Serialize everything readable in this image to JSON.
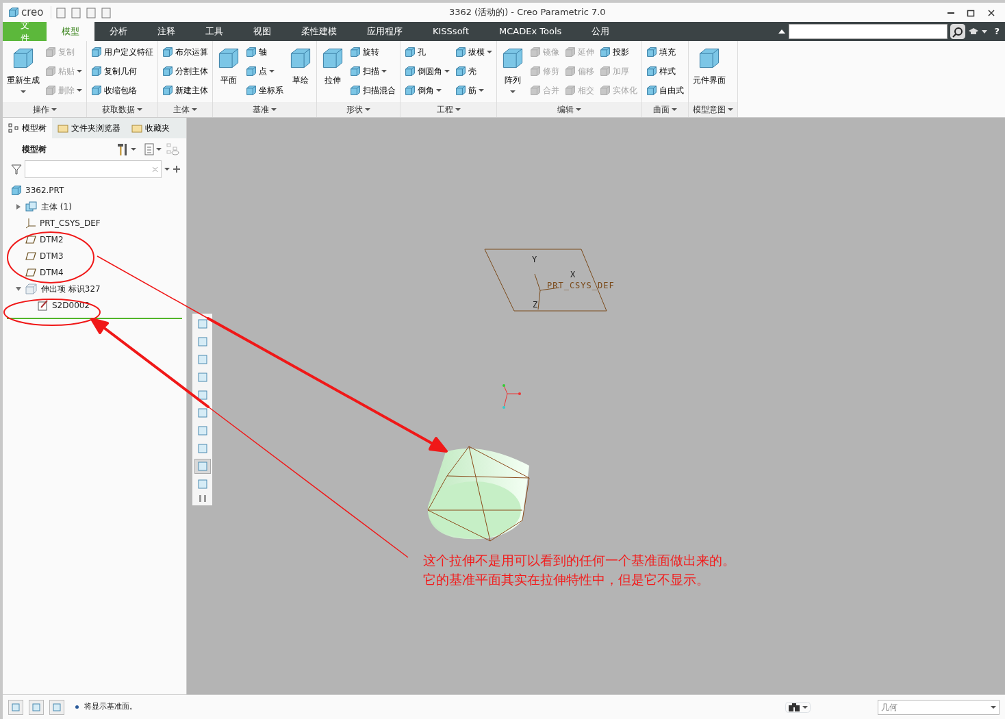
{
  "window": {
    "logo": "creo",
    "title": "3362 (活动的) - Creo Parametric 7.0"
  },
  "help": "?",
  "menu_tabs": [
    {
      "label": "文件",
      "kind": "file",
      "selected": false
    },
    {
      "label": "模型",
      "kind": "tab",
      "selected": true
    },
    {
      "label": "分析",
      "kind": "tab",
      "selected": false
    },
    {
      "label": "注释",
      "kind": "tab",
      "selected": false
    },
    {
      "label": "工具",
      "kind": "tab",
      "selected": false
    },
    {
      "label": "视图",
      "kind": "tab",
      "selected": false
    },
    {
      "label": "柔性建模",
      "kind": "tab",
      "selected": false
    },
    {
      "label": "应用程序",
      "kind": "tab",
      "selected": false
    },
    {
      "label": "KISSsoft",
      "kind": "tab",
      "selected": false
    },
    {
      "label": "MCADEx Tools",
      "kind": "tab",
      "selected": false
    },
    {
      "label": "公用",
      "kind": "tab",
      "selected": false
    }
  ],
  "ribbon_groups": [
    {
      "label": "操作",
      "items": [
        {
          "label": "重新生成",
          "kind": "large",
          "disabled": false,
          "dropdown": true
        },
        {
          "label": "复制",
          "kind": "small",
          "disabled": true,
          "dropdown": false
        },
        {
          "label": "粘贴",
          "kind": "small",
          "disabled": true,
          "dropdown": true
        },
        {
          "label": "删除",
          "kind": "small",
          "disabled": true,
          "dropdown": true
        }
      ]
    },
    {
      "label": "获取数据",
      "items": [
        {
          "label": "用户定义特征",
          "kind": "small",
          "disabled": false,
          "dropdown": false
        },
        {
          "label": "复制几何",
          "kind": "small",
          "disabled": false,
          "dropdown": false
        },
        {
          "label": "收缩包络",
          "kind": "small",
          "disabled": false,
          "dropdown": false
        }
      ]
    },
    {
      "label": "主体",
      "items": [
        {
          "label": "布尔运算",
          "kind": "small",
          "disabled": false,
          "dropdown": false
        },
        {
          "label": "分割主体",
          "kind": "small",
          "disabled": false,
          "dropdown": false
        },
        {
          "label": "新建主体",
          "kind": "small",
          "disabled": false,
          "dropdown": false
        }
      ]
    },
    {
      "label": "基准",
      "items": [
        {
          "label": "平面",
          "kind": "large",
          "disabled": false,
          "dropdown": false
        },
        {
          "label": "轴",
          "kind": "small",
          "disabled": false,
          "dropdown": false
        },
        {
          "label": "点",
          "kind": "small",
          "disabled": false,
          "dropdown": true
        },
        {
          "label": "坐标系",
          "kind": "small",
          "disabled": false,
          "dropdown": false
        },
        {
          "label": "草绘",
          "kind": "large",
          "disabled": false,
          "dropdown": false
        }
      ]
    },
    {
      "label": "形状",
      "items": [
        {
          "label": "拉伸",
          "kind": "large",
          "disabled": false,
          "dropdown": false
        },
        {
          "label": "旋转",
          "kind": "small",
          "disabled": false,
          "dropdown": false
        },
        {
          "label": "扫描",
          "kind": "small",
          "disabled": false,
          "dropdown": true
        },
        {
          "label": "扫描混合",
          "kind": "small",
          "disabled": false,
          "dropdown": false
        }
      ]
    },
    {
      "label": "工程",
      "items": [
        {
          "label": "孔",
          "kind": "small",
          "disabled": false,
          "dropdown": false
        },
        {
          "label": "倒圆角",
          "kind": "small",
          "disabled": false,
          "dropdown": true
        },
        {
          "label": "倒角",
          "kind": "small",
          "disabled": false,
          "dropdown": true
        },
        {
          "label": "拔模",
          "kind": "small",
          "disabled": false,
          "dropdown": true
        },
        {
          "label": "壳",
          "kind": "small",
          "disabled": false,
          "dropdown": false
        },
        {
          "label": "筋",
          "kind": "small",
          "disabled": false,
          "dropdown": true
        }
      ]
    },
    {
      "label": "编辑",
      "items": [
        {
          "label": "阵列",
          "kind": "large",
          "disabled": false,
          "dropdown": true
        },
        {
          "label": "镜像",
          "kind": "small",
          "disabled": true,
          "dropdown": false
        },
        {
          "label": "修剪",
          "kind": "small",
          "disabled": true,
          "dropdown": false
        },
        {
          "label": "合并",
          "kind": "small",
          "disabled": true,
          "dropdown": false
        },
        {
          "label": "延伸",
          "kind": "small",
          "disabled": true,
          "dropdown": false
        },
        {
          "label": "偏移",
          "kind": "small",
          "disabled": true,
          "dropdown": false
        },
        {
          "label": "相交",
          "kind": "small",
          "disabled": true,
          "dropdown": false
        },
        {
          "label": "投影",
          "kind": "small",
          "disabled": false,
          "dropdown": false
        },
        {
          "label": "加厚",
          "kind": "small",
          "disabled": true,
          "dropdown": false
        },
        {
          "label": "实体化",
          "kind": "small",
          "disabled": true,
          "dropdown": false
        }
      ]
    },
    {
      "label": "曲面",
      "items": [
        {
          "label": "填充",
          "kind": "small",
          "disabled": false,
          "dropdown": false
        },
        {
          "label": "样式",
          "kind": "small",
          "disabled": false,
          "dropdown": false
        },
        {
          "label": "自由式",
          "kind": "small",
          "disabled": false,
          "dropdown": false
        }
      ]
    },
    {
      "label": "模型意图",
      "items": [
        {
          "label": "元件界面",
          "kind": "large",
          "disabled": false,
          "dropdown": false
        }
      ]
    }
  ],
  "model_tree": {
    "tabs": [
      {
        "label": "模型树",
        "selected": true
      },
      {
        "label": "文件夹浏览器",
        "selected": false
      },
      {
        "label": "收藏夹",
        "selected": false
      }
    ],
    "title": "模型树",
    "items": [
      {
        "label": "3362.PRT",
        "kind": "part",
        "children": [
          {
            "label": "主体 (1)",
            "kind": "body",
            "expanded": false
          },
          {
            "label": "PRT_CSYS_DEF",
            "kind": "csys"
          },
          {
            "label": "DTM2",
            "kind": "plane"
          },
          {
            "label": "DTM3",
            "kind": "plane"
          },
          {
            "label": "DTM4",
            "kind": "plane"
          },
          {
            "label": "伸出项 标识327",
            "kind": "feature",
            "expanded": true,
            "children": [
              {
                "label": "S2D0002",
                "kind": "sketch"
              }
            ]
          }
        ]
      }
    ]
  },
  "graphics": {
    "csys_labels": {
      "y": "Y",
      "x": "X",
      "z": "Z",
      "name": "PRT_CSYS_DEF"
    },
    "view_toolbar": [
      {
        "selected": false
      },
      {
        "selected": false
      },
      {
        "selected": false
      },
      {
        "selected": false
      },
      {
        "selected": false
      },
      {
        "selected": false
      },
      {
        "selected": false
      },
      {
        "selected": false
      },
      {
        "selected": true
      },
      {
        "selected": false
      }
    ]
  },
  "annotation": {
    "lines": [
      "这个拉伸不是用可以看到的任何一个基准面做出来的。",
      "它的基准平面其实在拉伸特性中，但是它不显示。"
    ]
  },
  "status_bar": {
    "message": "将显示基准面。",
    "filter": "几何"
  }
}
